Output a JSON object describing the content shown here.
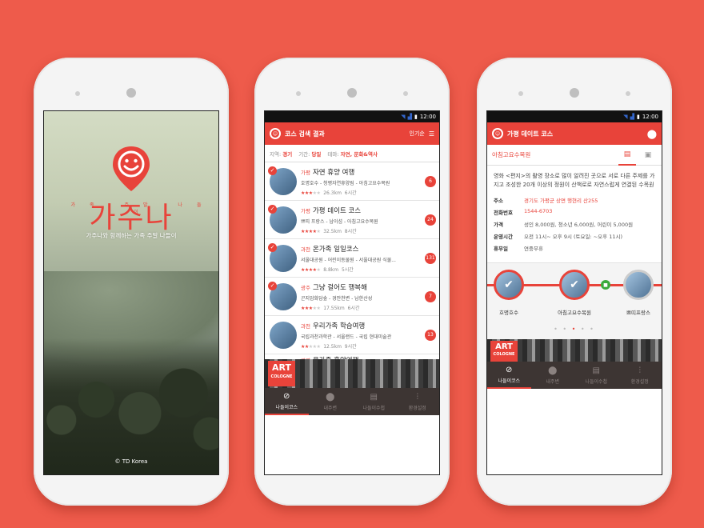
{
  "status": {
    "time": "12:00"
  },
  "splash": {
    "logo_text": "가주나",
    "logo_sub": "가족 주말 나들이",
    "tagline": "가주나와 함께하는 가족 주말 나들이",
    "copyright": "© TD Korea"
  },
  "list_screen": {
    "title": "코스 검색 결과",
    "sort_label": "인기순",
    "filters": [
      {
        "label": "지역:",
        "value": "경기"
      },
      {
        "label": "기간:",
        "value": "당일"
      },
      {
        "label": "테마:",
        "value": "자연, 문화&역사"
      }
    ],
    "items": [
      {
        "area": "가평",
        "title": "자연 휴양 여행",
        "places": "호명호수 - 청평자연휴양림 - 아침고요수목원",
        "rating": 3,
        "distance": "26.3km",
        "duration": "6시간",
        "count": "6",
        "checked": true
      },
      {
        "area": "가평",
        "title": "가평 데이트 코스",
        "places": "쁘띠 프랑스 - 남이섬 - 아침고요수목원",
        "rating": 4,
        "distance": "32.5km",
        "duration": "8시간",
        "count": "24",
        "checked": true
      },
      {
        "area": "과천",
        "title": "온가족 일일코스",
        "places": "서울대공원 - 어린이동물원 - 서울대공원 식물...",
        "rating": 4,
        "distance": "8.8km",
        "duration": "5시간",
        "count": "131",
        "checked": true
      },
      {
        "area": "광주",
        "title": "그냥 걸어도 행복해",
        "places": "곤지암화담숲 - 경안천변 - 남한산성",
        "rating": 3,
        "distance": "17.55km",
        "duration": "6시간",
        "count": "7",
        "checked": true
      },
      {
        "area": "과천",
        "title": "우리가족 학습여행",
        "places": "국립과천과학관 - 서울랜드 - 국립 현대미술관",
        "rating": 2,
        "distance": "12.5km",
        "duration": "9시간",
        "count": "13",
        "checked": false
      }
    ],
    "partial_item": {
      "area": "광명",
      "title": "온가족 휴양여행"
    }
  },
  "ad": {
    "line1": "ART",
    "line2": "COLOGNE"
  },
  "tabs": [
    {
      "label": "나들이코스",
      "icon": "compass-icon",
      "glyph": "⊘"
    },
    {
      "label": "내주변",
      "icon": "location-pin-icon",
      "glyph": "⬤"
    },
    {
      "label": "나들이수첩",
      "icon": "notebook-icon",
      "glyph": "▤"
    },
    {
      "label": "환경설정",
      "icon": "settings-sliders-icon",
      "glyph": "⫶"
    }
  ],
  "detail_screen": {
    "title": "가평 데이트 코스",
    "place_name": "아침고요수목원",
    "description": "영화 <편지>의 촬영 장소로 많이 알려진 곳으로 서로 다른 주제를 가지고 조성한 20개 이상의 정원이 산책로로 자연스럽게 연결된 수목원",
    "info": [
      {
        "key": "주소",
        "value": "경기도 가평군 상면 행현리 산255",
        "highlight": true
      },
      {
        "key": "전화번호",
        "value": "1544-6703",
        "highlight": true
      },
      {
        "key": "가격",
        "value": "성인 8,000원, 청소년 6,000원, 어린이 5,000원",
        "highlight": false
      },
      {
        "key": "운영시간",
        "value": "오전 11시~ 오후 9시 (토요일: ~오후 11시)",
        "highlight": false
      },
      {
        "key": "휴무일",
        "value": "연중무휴",
        "highlight": false
      }
    ],
    "stops": [
      "호명호수",
      "아침고요수목원",
      "쁘띠프랑스"
    ]
  },
  "colors": {
    "accent": "#e8433a",
    "background": "#ee5b4b",
    "tabbar": "#3d3533"
  }
}
